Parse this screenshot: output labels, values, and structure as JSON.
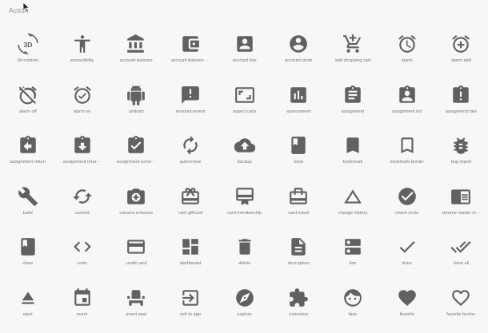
{
  "section": {
    "title": "Action"
  },
  "colors": {
    "icon": "#616161",
    "label": "#777777",
    "background": "#f7f7f7"
  },
  "icons": [
    {
      "label": "3d rotation",
      "icon": "3d-rotation-icon"
    },
    {
      "label": "accessibility",
      "icon": "accessibility-icon"
    },
    {
      "label": "account balance",
      "icon": "account-balance-icon"
    },
    {
      "label": "account balance ···",
      "icon": "account-balance-wallet-icon"
    },
    {
      "label": "account box",
      "icon": "account-box-icon"
    },
    {
      "label": "account circle",
      "icon": "account-circle-icon"
    },
    {
      "label": "add shopping cart",
      "icon": "add-shopping-cart-icon"
    },
    {
      "label": "alarm",
      "icon": "alarm-icon"
    },
    {
      "label": "alarm add",
      "icon": "alarm-add-icon"
    },
    {
      "label": "alarm off",
      "icon": "alarm-off-icon"
    },
    {
      "label": "alarm on",
      "icon": "alarm-on-icon"
    },
    {
      "label": "android",
      "icon": "android-icon"
    },
    {
      "label": "announcement",
      "icon": "announcement-icon"
    },
    {
      "label": "aspect ratio",
      "icon": "aspect-ratio-icon"
    },
    {
      "label": "assessment",
      "icon": "assessment-icon"
    },
    {
      "label": "assignment",
      "icon": "assignment-icon"
    },
    {
      "label": "assignment ind",
      "icon": "assignment-ind-icon"
    },
    {
      "label": "assignment late",
      "icon": "assignment-late-icon"
    },
    {
      "label": "assignment return",
      "icon": "assignment-return-icon"
    },
    {
      "label": "assignment retur···",
      "icon": "assignment-returned-icon"
    },
    {
      "label": "assignment turne···",
      "icon": "assignment-turned-in-icon"
    },
    {
      "label": "autorenew",
      "icon": "autorenew-icon"
    },
    {
      "label": "backup",
      "icon": "backup-icon"
    },
    {
      "label": "book",
      "icon": "book-icon"
    },
    {
      "label": "bookmark",
      "icon": "bookmark-icon"
    },
    {
      "label": "bookmark border",
      "icon": "bookmark-border-icon"
    },
    {
      "label": "bug report",
      "icon": "bug-report-icon"
    },
    {
      "label": "build",
      "icon": "build-icon"
    },
    {
      "label": "cached",
      "icon": "cached-icon"
    },
    {
      "label": "camera enhance",
      "icon": "camera-enhance-icon"
    },
    {
      "label": "card giftcard",
      "icon": "card-giftcard-icon"
    },
    {
      "label": "card membership",
      "icon": "card-membership-icon"
    },
    {
      "label": "card travel",
      "icon": "card-travel-icon"
    },
    {
      "label": "change history",
      "icon": "change-history-icon"
    },
    {
      "label": "check circle",
      "icon": "check-circle-icon"
    },
    {
      "label": "chrome reader m···",
      "icon": "chrome-reader-mode-icon"
    },
    {
      "label": "class",
      "icon": "class-icon"
    },
    {
      "label": "code",
      "icon": "code-icon"
    },
    {
      "label": "credit card",
      "icon": "credit-card-icon"
    },
    {
      "label": "dashboard",
      "icon": "dashboard-icon"
    },
    {
      "label": "delete",
      "icon": "delete-icon"
    },
    {
      "label": "description",
      "icon": "description-icon"
    },
    {
      "label": "dns",
      "icon": "dns-icon"
    },
    {
      "label": "done",
      "icon": "done-icon"
    },
    {
      "label": "done all",
      "icon": "done-all-icon"
    },
    {
      "label": "eject",
      "icon": "eject-icon"
    },
    {
      "label": "event",
      "icon": "event-icon"
    },
    {
      "label": "event seat",
      "icon": "event-seat-icon"
    },
    {
      "label": "exit to app",
      "icon": "exit-to-app-icon"
    },
    {
      "label": "explore",
      "icon": "explore-icon"
    },
    {
      "label": "extension",
      "icon": "extension-icon"
    },
    {
      "label": "face",
      "icon": "face-icon"
    },
    {
      "label": "favorite",
      "icon": "favorite-icon"
    },
    {
      "label": "favorite border",
      "icon": "favorite-border-icon"
    }
  ]
}
